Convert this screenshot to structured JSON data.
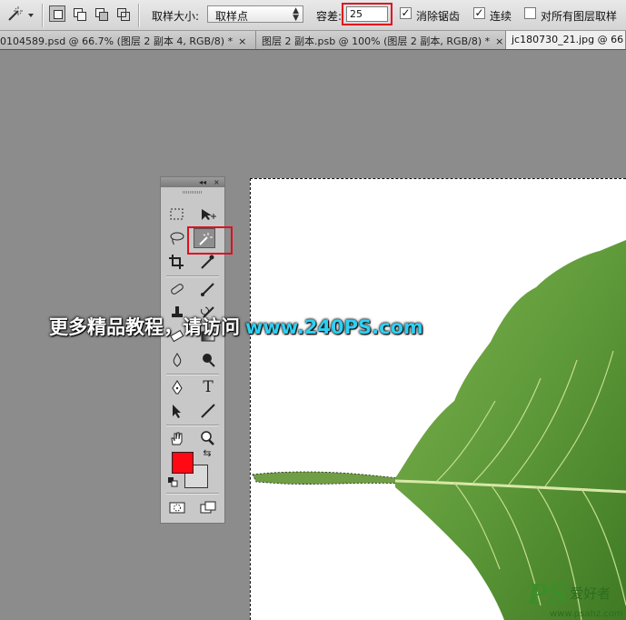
{
  "options_bar": {
    "tool_preset_icon": "magic-wand-icon",
    "selection_modes": [
      "new-selection-icon",
      "add-to-selection-icon",
      "subtract-from-selection-icon",
      "intersect-selection-icon"
    ],
    "sample_size_label": "取样大小:",
    "sample_size_value": "取样点",
    "tolerance_label": "容差:",
    "tolerance_value": "25",
    "antialias_label": "消除锯齿",
    "antialias_checked": true,
    "contiguous_label": "连续",
    "contiguous_checked": true,
    "sample_all_layers_label": "对所有图层取样",
    "sample_all_layers_checked": false
  },
  "tabs": [
    {
      "label": "0104589.psd @ 66.7% (图层 2 副本 4, RGB/8) *",
      "close": "×"
    },
    {
      "label": "图层 2 副本.psb @ 100% (图层 2 副本, RGB/8) *",
      "close": "×"
    },
    {
      "label": "jc180730_21.jpg @ 66",
      "close": ""
    }
  ],
  "toolbox": {
    "collapse_glyph": "◂◂",
    "close_glyph": "×",
    "tools": [
      "marquee-icon",
      "move-icon",
      "lasso-icon",
      "magic-wand-icon",
      "crop-icon",
      "eyedropper-icon",
      "healing-brush-icon",
      "brush-icon",
      "clone-stamp-icon",
      "history-brush-icon",
      "eraser-icon",
      "gradient-icon",
      "blur-icon",
      "dodge-icon",
      "pen-icon",
      "type-icon",
      "path-selection-icon",
      "line-icon",
      "hand-icon",
      "zoom-icon",
      "quick-mask-icon",
      "screen-mode-icon"
    ],
    "type_glyph": "T",
    "foreground_color": "#ff0a14",
    "background_color": "#dadada"
  },
  "overlay": {
    "promo_text": "更多精品教程，请访问",
    "promo_url": "www.240PS.com",
    "watermark_logo": "PS",
    "watermark_text": "爱好者",
    "watermark_url": "www.psahz.com"
  },
  "colors": {
    "highlight_red": "#e0101e",
    "workspace_gray": "#8c8c8c",
    "promo_cyan": "#2fd0f2",
    "leaf_green": "#5f9a3a"
  }
}
